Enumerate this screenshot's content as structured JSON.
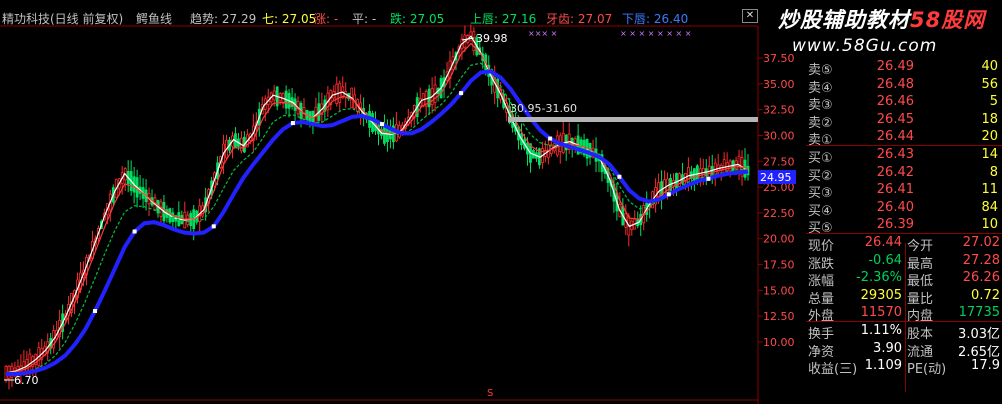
{
  "title_bar": {
    "stock_label": "精功科技(日线 前复权)",
    "indicator_name": "鳄鱼线",
    "trend_label": "趋势: 27.29",
    "seven_label": "七: 27.05",
    "up_label": "涨: -",
    "flat_label": "平: -",
    "down_label": "跌: 27.05",
    "upper_label": "上唇: 27.16",
    "mid_label": "牙齿: 27.07",
    "lower_label": "下唇: 26.40"
  },
  "watermark": {
    "line1_white": "炒股辅助教材",
    "line1_red": "58股网",
    "line2": "www.58Gu.com"
  },
  "price_axis": {
    "ticks": [
      "37.50",
      "35.00",
      "32.50",
      "30.00",
      "27.50",
      "25.00",
      "22.50",
      "20.00",
      "17.50",
      "15.00",
      "12.50",
      "10.00"
    ],
    "current_price_tag": "24.95"
  },
  "annotations": {
    "high_label": "39.98",
    "low_label": "6.70",
    "range_label": "30.95-31.60",
    "bottom_marker": "S"
  },
  "quote_panel": {
    "asks": [
      {
        "label": "卖⑤",
        "price": "26.49",
        "volume": "40"
      },
      {
        "label": "卖④",
        "price": "26.48",
        "volume": "56"
      },
      {
        "label": "卖③",
        "price": "26.46",
        "volume": "5"
      },
      {
        "label": "卖②",
        "price": "26.45",
        "volume": "18"
      },
      {
        "label": "卖①",
        "price": "26.44",
        "volume": "20"
      }
    ],
    "bids": [
      {
        "label": "买①",
        "price": "26.43",
        "volume": "14"
      },
      {
        "label": "买②",
        "price": "26.42",
        "volume": "8"
      },
      {
        "label": "买③",
        "price": "26.41",
        "volume": "11"
      },
      {
        "label": "买④",
        "price": "26.40",
        "volume": "84"
      },
      {
        "label": "买⑤",
        "price": "26.39",
        "volume": "10"
      }
    ],
    "stats": [
      {
        "l1": "现价",
        "v1": "26.44",
        "l2": "今开",
        "v2": "27.02"
      },
      {
        "l1": "涨跌",
        "v1": "-0.64",
        "l2": "最高",
        "v2": "27.28"
      },
      {
        "l1": "涨幅",
        "v1": "-2.36%",
        "l2": "最低",
        "v2": "26.26"
      },
      {
        "l1": "总量",
        "v1": "29305",
        "l2": "量比",
        "v2": "0.72"
      },
      {
        "l1": "外盘",
        "v1": "11570",
        "l2": "内盘",
        "v2": "17735"
      }
    ],
    "fund": [
      {
        "l1": "换手",
        "v1": "1.11%",
        "l2": "股本",
        "v2": "3.03亿"
      },
      {
        "l1": "净资",
        "v1": "3.90",
        "l2": "流通",
        "v2": "2.65亿"
      },
      {
        "l1": "收益(三)",
        "v1": "1.109",
        "l2": "PE(动)",
        "v2": "17.9"
      }
    ]
  },
  "colors": {
    "candle_up": "#ff2b2b",
    "candle_down": "#00e060",
    "jaw": "#2222ff",
    "resistance": "#b4b4b4",
    "background": "#000000",
    "grid": "#8a0000"
  },
  "chart_data": {
    "type": "line",
    "title": "精功科技(日线 前复权)",
    "xlabel": "",
    "ylabel": "",
    "ylim": [
      6.0,
      40.5
    ],
    "y_ticks": [
      10.0,
      12.5,
      15.0,
      17.5,
      20.0,
      22.5,
      25.0,
      27.5,
      30.0,
      32.5,
      35.0,
      37.5
    ],
    "x": [
      0,
      10,
      20,
      30,
      40,
      50,
      60,
      70,
      80,
      90,
      100,
      110,
      120,
      130,
      140,
      150,
      160,
      170,
      180,
      190,
      200,
      210,
      220,
      230,
      240,
      250,
      260,
      270,
      280,
      290,
      300,
      310,
      320,
      330,
      340,
      350,
      360,
      370,
      380,
      390,
      400,
      410,
      420,
      430,
      440,
      450,
      460,
      470,
      480,
      490,
      500,
      510,
      520,
      530,
      540,
      550,
      560,
      570,
      580,
      590,
      600,
      610,
      620,
      630,
      640,
      650,
      660,
      670,
      680,
      690,
      700,
      710,
      720,
      730,
      740,
      750
    ],
    "series": [
      {
        "values": [
          7.0,
          7.2,
          7.6,
          8.3,
          9.2,
          10.5,
          12.4,
          14.6,
          17.0,
          19.6,
          22.3,
          24.6,
          26.3,
          25.2,
          24.3,
          23.4,
          22.6,
          22.0,
          21.8,
          21.9,
          22.8,
          25.5,
          28.3,
          29.6,
          29.0,
          30.2,
          32.8,
          33.9,
          33.6,
          33.2,
          32.2,
          31.7,
          32.6,
          33.9,
          34.2,
          33.6,
          32.3,
          31.3,
          30.2,
          30.1,
          30.5,
          31.9,
          33.4,
          33.7,
          34.6,
          36.6,
          38.8,
          39.6,
          38.0,
          35.8,
          34.0,
          31.8,
          29.8,
          28.3,
          27.9,
          28.6,
          29.2,
          29.4,
          29.0,
          28.6,
          27.8,
          25.8,
          22.8,
          21.2,
          21.6,
          23.3,
          24.6,
          25.2,
          25.6,
          26.1,
          26.3,
          26.5,
          26.8,
          27.0,
          27.2,
          26.6
        ]
      },
      {
        "values": [
          7.0,
          7.1,
          7.4,
          8.0,
          8.8,
          10.0,
          11.8,
          13.9,
          16.2,
          18.7,
          21.2,
          23.5,
          25.3,
          25.0,
          24.3,
          23.5,
          22.8,
          22.2,
          21.9,
          21.9,
          22.5,
          24.6,
          27.2,
          28.8,
          28.8,
          29.6,
          31.7,
          33.1,
          33.2,
          33.0,
          32.2,
          31.7,
          32.2,
          33.3,
          33.8,
          33.5,
          32.5,
          31.5,
          30.4,
          30.2,
          30.4,
          31.4,
          32.8,
          33.3,
          34.1,
          35.8,
          37.9,
          38.9,
          37.9,
          36.1,
          34.4,
          32.4,
          30.5,
          29.0,
          28.4,
          28.6,
          29.0,
          29.2,
          29.0,
          28.7,
          28.0,
          26.4,
          23.8,
          22.0,
          21.9,
          22.9,
          24.1,
          24.8,
          25.3,
          25.8,
          26.1,
          26.3,
          26.6,
          26.8,
          27.0,
          26.8
        ]
      },
      {
        "values": [
          7.0,
          7.0,
          7.1,
          7.4,
          7.9,
          8.7,
          10.0,
          11.8,
          13.9,
          16.2,
          18.6,
          20.8,
          22.6,
          23.2,
          23.1,
          22.8,
          22.4,
          22.0,
          21.7,
          21.6,
          21.9,
          23.1,
          24.9,
          26.6,
          27.6,
          28.4,
          29.8,
          31.3,
          31.9,
          32.0,
          31.6,
          31.2,
          31.3,
          31.9,
          32.5,
          32.6,
          32.1,
          31.4,
          30.6,
          30.2,
          30.1,
          30.6,
          31.5,
          32.3,
          33.0,
          34.1,
          35.6,
          36.8,
          37.0,
          36.1,
          34.8,
          33.2,
          31.5,
          30.1,
          29.3,
          29.0,
          29.0,
          29.0,
          28.9,
          28.6,
          28.1,
          27.0,
          25.1,
          23.6,
          22.9,
          23.1,
          23.8,
          24.5,
          25.0,
          25.5,
          25.8,
          26.1,
          26.3,
          26.5,
          26.7,
          26.7
        ]
      },
      {
        "values": [
          6.9,
          6.9,
          7.0,
          7.2,
          7.5,
          8.0,
          8.7,
          9.8,
          11.2,
          13.0,
          15.0,
          17.1,
          19.2,
          20.7,
          21.5,
          21.6,
          21.3,
          20.9,
          20.6,
          20.5,
          20.6,
          21.2,
          22.6,
          24.3,
          25.9,
          27.2,
          28.4,
          29.6,
          30.6,
          31.2,
          31.3,
          31.1,
          30.9,
          31.0,
          31.4,
          31.8,
          31.9,
          31.6,
          31.1,
          30.6,
          30.2,
          30.2,
          30.6,
          31.3,
          32.1,
          33.0,
          34.1,
          35.3,
          36.1,
          36.2,
          35.6,
          34.5,
          33.1,
          31.7,
          30.5,
          29.7,
          29.2,
          28.9,
          28.6,
          28.3,
          27.9,
          27.2,
          26.0,
          24.7,
          23.9,
          23.6,
          23.8,
          24.3,
          24.8,
          25.2,
          25.6,
          25.8,
          26.1,
          26.3,
          26.4,
          26.5
        ]
      }
    ],
    "grid": false,
    "legend": "none"
  }
}
